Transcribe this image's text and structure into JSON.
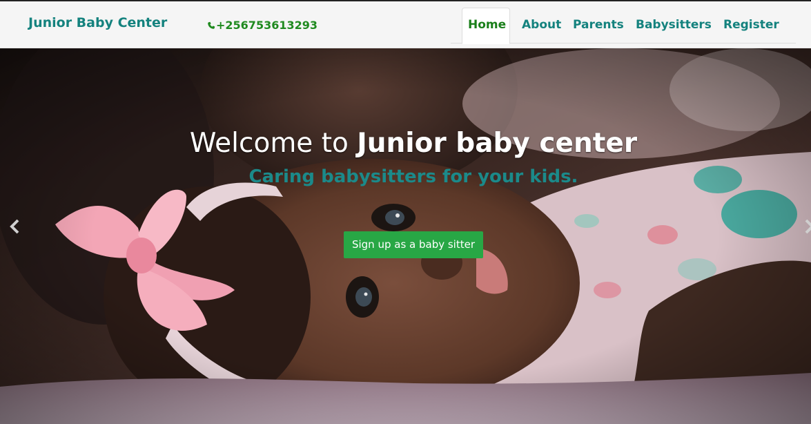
{
  "brand": {
    "name": "Junior Baby Center",
    "color": "#14827e"
  },
  "contact": {
    "phone": "+256753613293",
    "icon": "phone-icon",
    "color": "#1f8a1f"
  },
  "nav": {
    "items": [
      {
        "label": "Home",
        "active": true
      },
      {
        "label": "About",
        "active": false
      },
      {
        "label": "Parents",
        "active": false
      },
      {
        "label": "Babysitters",
        "active": false
      },
      {
        "label": "Register",
        "active": false
      }
    ]
  },
  "hero": {
    "welcome_prefix": "Welcome to",
    "welcome_emphasis": "Junior baby center",
    "tagline": "Caring babysitters for your kids.",
    "cta_label": "Sign up as a baby sitter",
    "cta_color": "#28a745",
    "prev_icon": "chevron-left-icon",
    "next_icon": "chevron-right-icon"
  }
}
